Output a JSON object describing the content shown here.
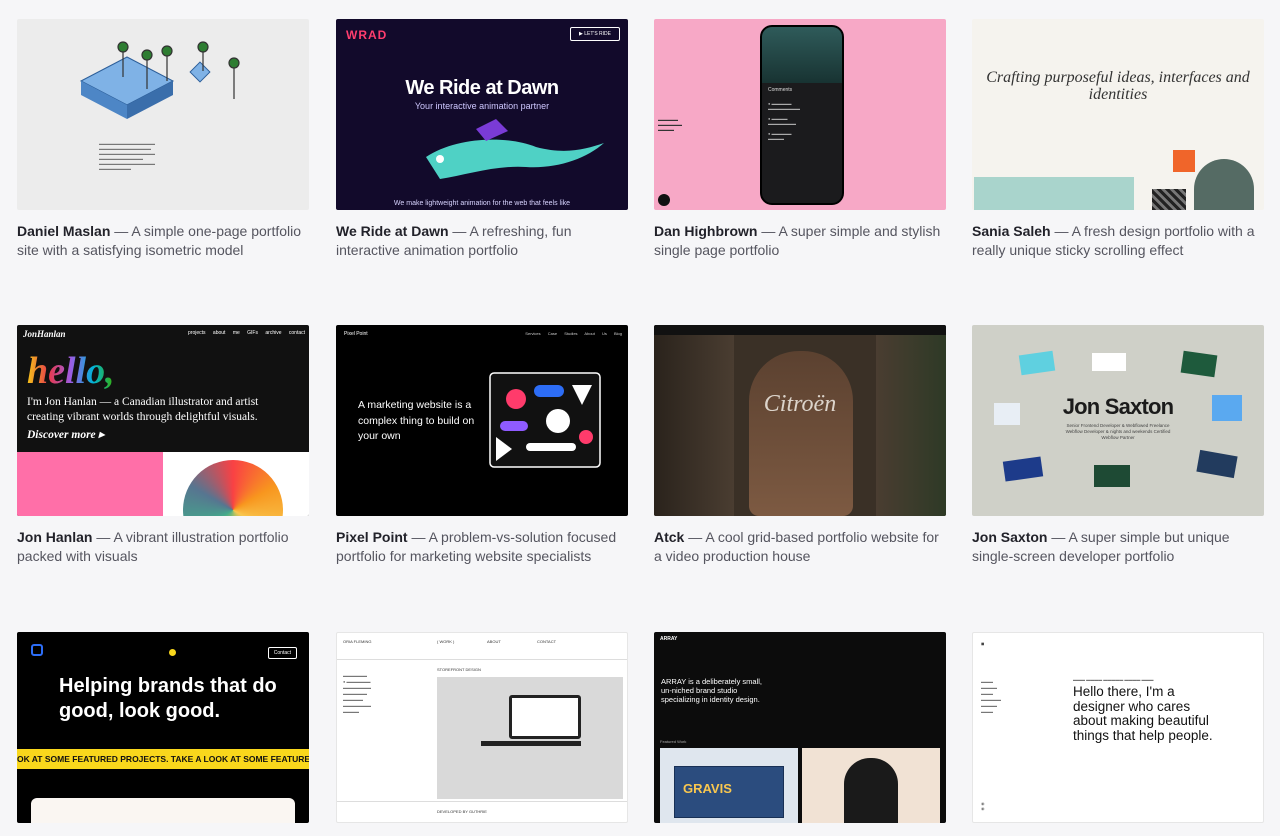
{
  "cards": [
    {
      "name": "Daniel Maslan",
      "desc": " — A simple one-page portfolio site with a satisfying isometric model",
      "thumb": {
        "type": "isometric-page"
      }
    },
    {
      "name": "We Ride at Dawn",
      "desc": " — A refreshing, fun interactive animation portfolio",
      "thumb": {
        "logo": "WRAD",
        "button": "LET'S RIDE",
        "headline": "We Ride at Dawn",
        "subhead": "Your interactive animation partner",
        "footer": "We make lightweight animation for the web that feels like"
      }
    },
    {
      "name": "Dan Highbrown",
      "desc": " — A super simple and stylish single page portfolio",
      "thumb": {
        "panel_title": "Comments"
      }
    },
    {
      "name": "Sania Saleh",
      "desc": " — A fresh design portfolio with a really unique sticky scrolling effect",
      "thumb": {
        "headline": "Crafting purposeful ideas, interfaces and identities"
      }
    },
    {
      "name": "Jon Hanlan",
      "desc": " — A vibrant illustration portfolio packed with visuals",
      "thumb": {
        "brand": "JonHanlan",
        "nav": "projects about me GIFs archive contact",
        "hello": "hello,",
        "intro": "I'm Jon Hanlan — a Canadian illustrator and artist creating vibrant worlds through delightful visuals.",
        "discover": "Discover more ▸"
      }
    },
    {
      "name": "Pixel Point",
      "desc": " — A problem-vs-solution focused portfolio for marketing website specialists",
      "thumb": {
        "brand": "Pixel Point",
        "nav": "Services Case Studies About Us Blog",
        "headline": "A marketing website is a complex thing to build on your own"
      }
    },
    {
      "name": "Atck",
      "desc": " — A cool grid-based portfolio website for a video production house",
      "thumb": {
        "headline": "Citroën"
      }
    },
    {
      "name": "Jon Saxton",
      "desc": " — A super simple but unique single-screen developer portfolio",
      "thumb": {
        "headline": "Jon Saxton",
        "subhead": "Senior Frontend Developer & Webflowed Freelance Webflow Developer & nights and weekends Certified Webflow Partner"
      }
    },
    {
      "name": "",
      "desc": "",
      "thumb": {
        "headline": "Helping brands that do good, look good.",
        "band": "OK AT SOME FEATURED PROJECTS.   TAKE A LOOK AT SOME FEATURED PROJECTS.   TAKE A LOOK AT SOME FEATURED PRO",
        "button": "Contact"
      }
    },
    {
      "name": "",
      "desc": "",
      "thumb": {
        "brand": "ORIA FLEMING",
        "nav1": "( WORK )",
        "nav2": "ABOUT",
        "nav3": "CONTACT",
        "project": "STOREFRONT DESIGN",
        "footer": "DEVELOPED BY GUTHRIE"
      }
    },
    {
      "name": "",
      "desc": "",
      "thumb": {
        "brand": "ARRAY",
        "headline": "ARRAY is a deliberately small, un-niched brand studio specializing in identity design.",
        "label": "Featured Work",
        "container_text": "GRAVIS"
      }
    },
    {
      "name": "",
      "desc": "",
      "thumb": {
        "headline": "Hello there, I'm a designer who cares about making beautiful things that help people."
      }
    }
  ],
  "colors": {
    "page_bg": "#f6f6f8",
    "wrad_pink": "#ff3d6e",
    "pink_bg": "#f7a8c6",
    "yellow_band": "#f9d71c"
  }
}
